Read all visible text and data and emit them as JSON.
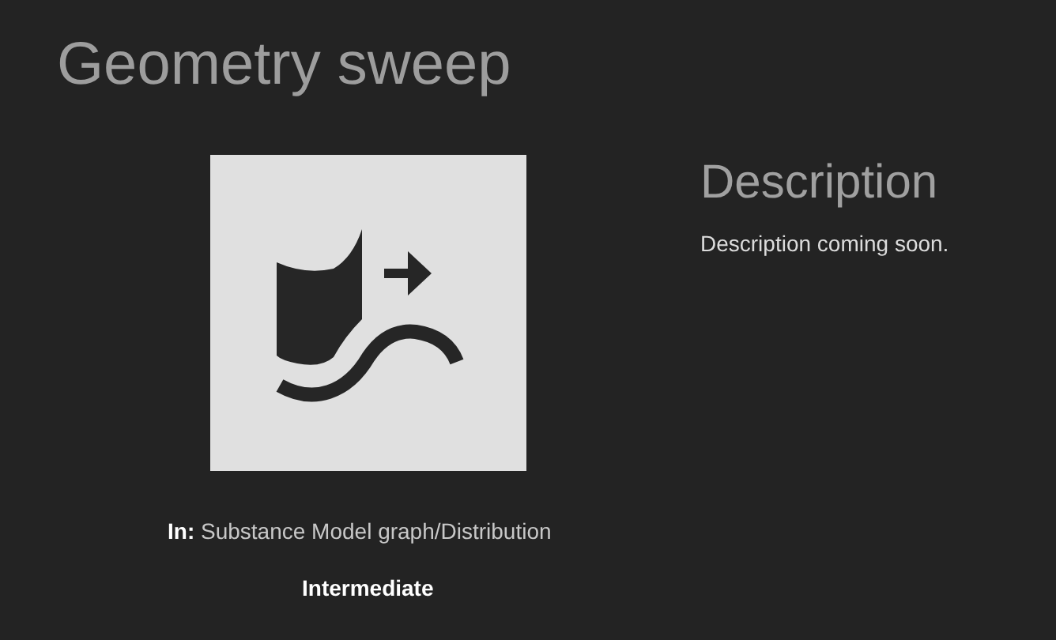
{
  "title": "Geometry sweep",
  "thumbnail": {
    "kind": "icon"
  },
  "location": "**In:** Substance Model graph/Distribution",
  "level": "Intermediate",
  "description": {
    "heading": "Description",
    "text": "Description coming soon."
  }
}
